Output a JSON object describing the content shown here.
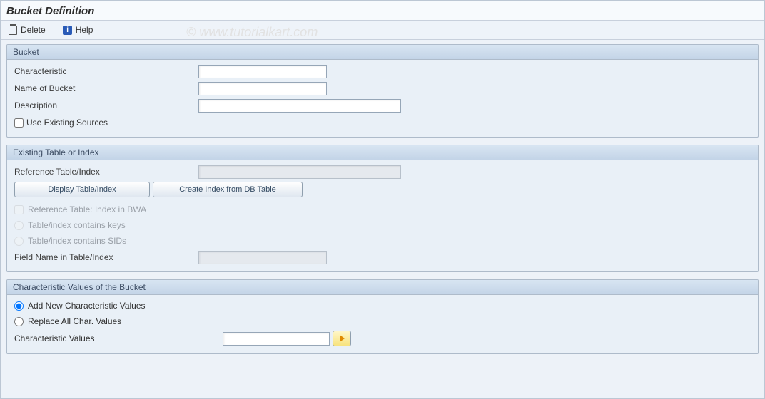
{
  "page_title": "Bucket Definition",
  "watermark": "© www.tutorialkart.com",
  "toolbar": {
    "delete_label": "Delete",
    "help_label": "Help"
  },
  "bucket": {
    "group_title": "Bucket",
    "characteristic_label": "Characteristic",
    "characteristic_value": "",
    "name_label": "Name of Bucket",
    "name_value": "",
    "description_label": "Description",
    "description_value": "",
    "use_existing_label": "Use Existing Sources",
    "use_existing_checked": false
  },
  "existing": {
    "group_title": "Existing Table or Index",
    "ref_table_label": "Reference Table/Index",
    "ref_table_value": "",
    "btn_display_label": "Display Table/Index",
    "btn_create_label": "Create Index from DB Table",
    "chk_bwa_label": "Reference Table: Index in BWA",
    "chk_bwa_checked": false,
    "radio_keys_label": "Table/index contains keys",
    "radio_sids_label": "Table/index contains SIDs",
    "radio_selected": null,
    "field_name_label": "Field Name in Table/Index",
    "field_name_value": ""
  },
  "charvals": {
    "group_title": "Characteristic Values of the Bucket",
    "radio_add_label": "Add New Characteristic Values",
    "radio_replace_label": "Replace All Char. Values",
    "radio_selected": "add",
    "values_label": "Characteristic Values",
    "values_value": ""
  }
}
